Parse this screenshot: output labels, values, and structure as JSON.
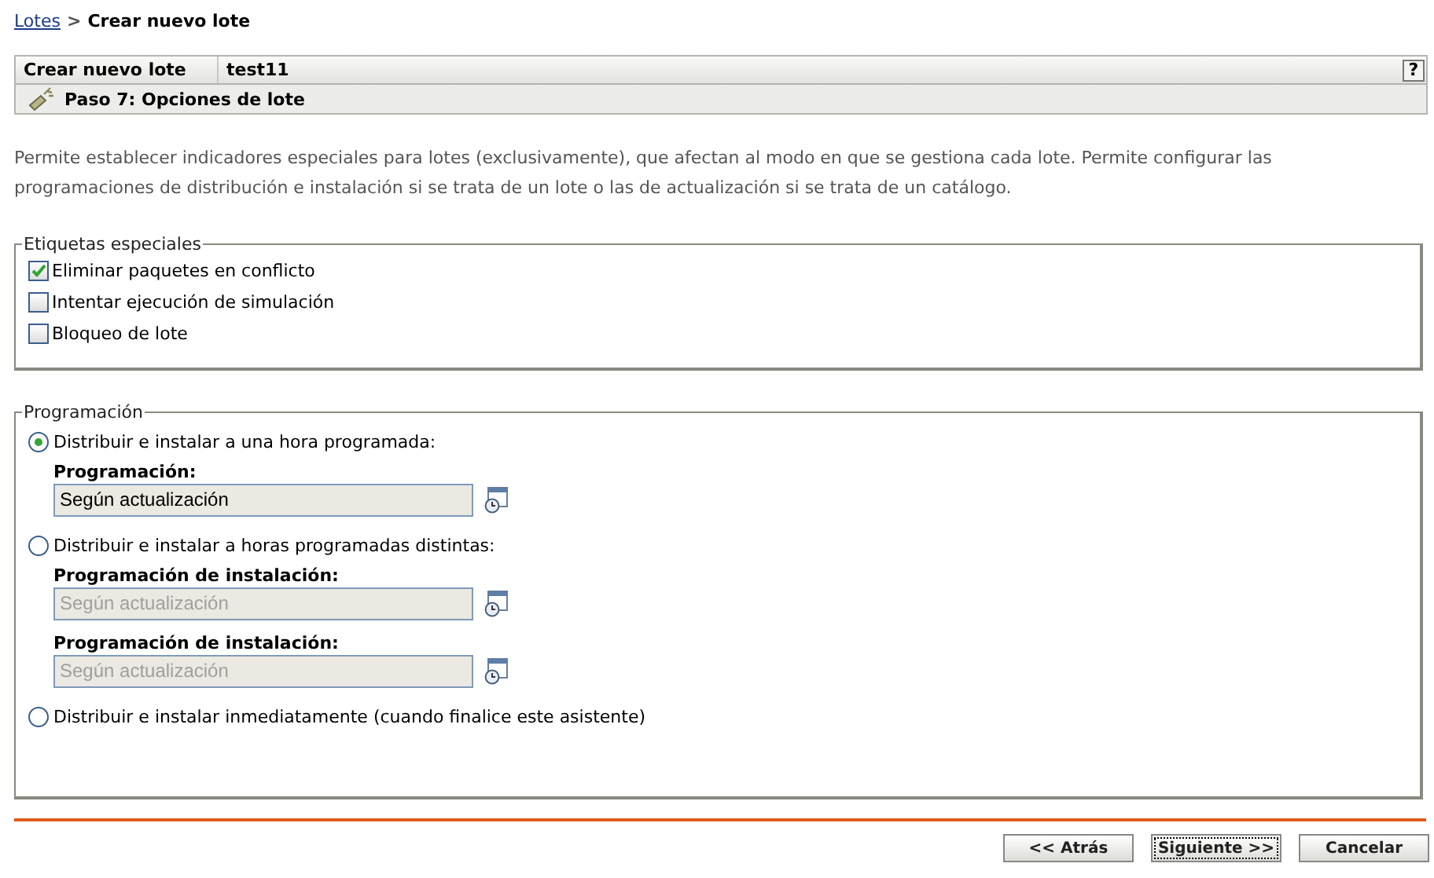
{
  "breadcrumb": {
    "link": "Lotes",
    "separator": ">",
    "current": "Crear nuevo lote"
  },
  "header": {
    "title": "Crear nuevo lote",
    "name": "test11",
    "help": "?",
    "step": "Paso 7: Opciones de lote"
  },
  "description": "Permite establecer indicadores especiales para lotes (exclusivamente), que afectan al modo en que se gestiona cada lote. Permite configurar las programaciones de distribución e instalación si se trata de un lote o las de actualización si se trata de un catálogo.",
  "special_labels": {
    "legend": "Etiquetas especiales",
    "items": [
      {
        "label": "Eliminar paquetes en conflicto",
        "checked": true
      },
      {
        "label": "Intentar ejecución de simulación",
        "checked": false
      },
      {
        "label": "Bloqueo de lote",
        "checked": false
      }
    ]
  },
  "schedule": {
    "legend": "Programación",
    "options": [
      {
        "label": "Distribuir e instalar a una hora programada:",
        "selected": true,
        "fields": [
          {
            "label": "Programación:",
            "value": "Según actualización",
            "disabled": false
          }
        ]
      },
      {
        "label": "Distribuir e instalar a horas programadas distintas:",
        "selected": false,
        "fields": [
          {
            "label": "Programación de instalación:",
            "value": "Según actualización",
            "disabled": true
          },
          {
            "label": "Programación de instalación:",
            "value": "Según actualización",
            "disabled": true
          }
        ]
      },
      {
        "label": "Distribuir e instalar inmediatamente (cuando finalice este asistente)",
        "selected": false
      }
    ]
  },
  "buttons": [
    {
      "label": "<< Atrás",
      "focused": false
    },
    {
      "label": "Siguiente >>",
      "focused": true
    },
    {
      "label": "Cancelar",
      "focused": false
    }
  ]
}
